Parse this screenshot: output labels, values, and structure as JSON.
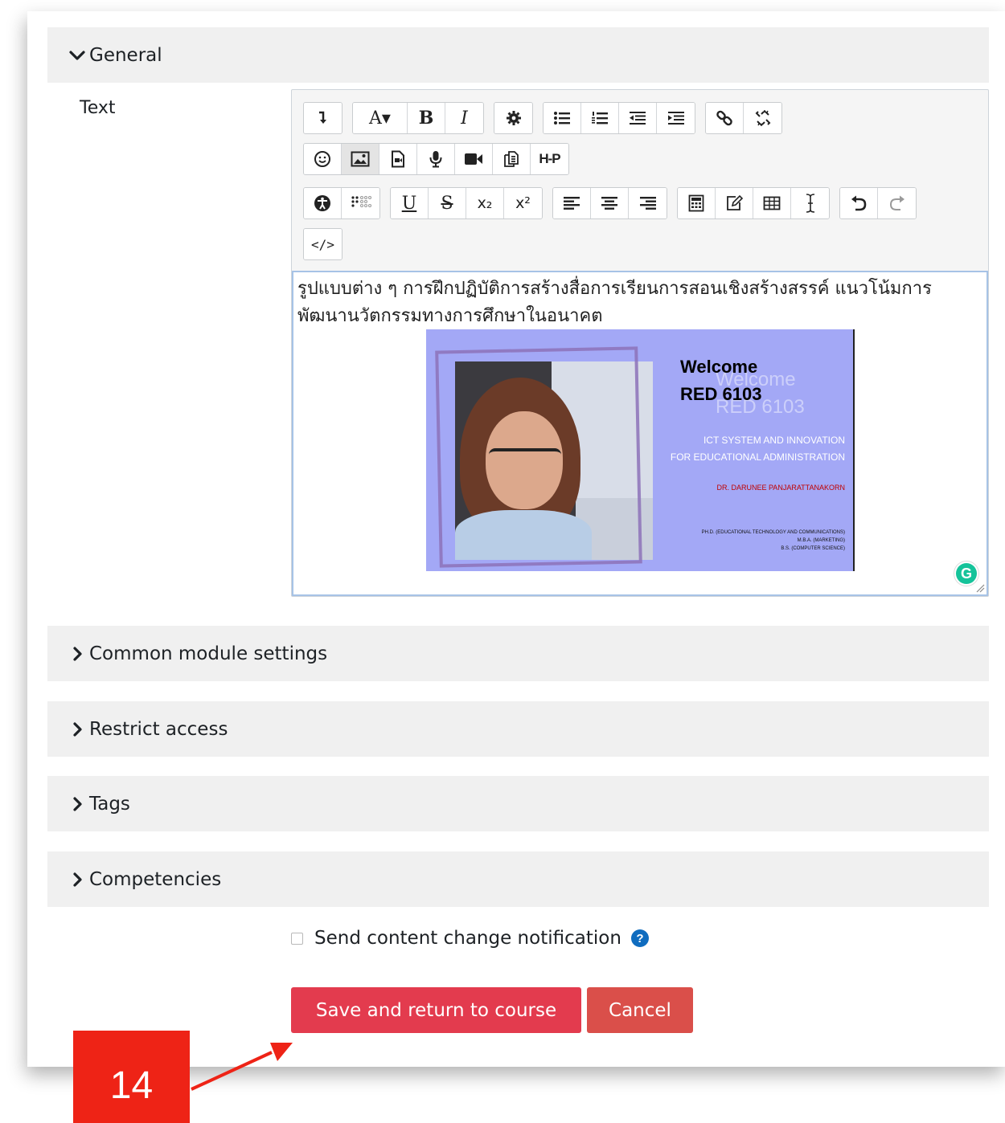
{
  "sections": {
    "general": "General",
    "common_module_settings": "Common module settings",
    "restrict_access": "Restrict access",
    "tags": "Tags",
    "competencies": "Competencies"
  },
  "text_field": {
    "label": "Text",
    "content": "รูปแบบต่าง ๆ การฝึกปฏิบัติการสร้างสื่อการเรียนการสอนเชิงสร้างสรรค์ แนวโน้มการพัฒนานวัตกรรมทางการศึกษาในอนาคต"
  },
  "toolbar": {
    "row1": [
      "expand-toolbar-icon",
      "font-color-icon",
      "bold-icon",
      "italic-icon",
      "settings-icon",
      "bulleted-list-icon",
      "numbered-list-icon",
      "outdent-icon",
      "indent-icon",
      "link-icon",
      "unlink-icon"
    ],
    "row2": [
      "emoji-icon",
      "image-icon",
      "media-file-icon",
      "record-audio-icon",
      "record-video-icon",
      "manage-files-icon",
      "h5p-icon"
    ],
    "row3": [
      "accessibility-checker-icon",
      "screenreader-helper-icon",
      "underline-icon",
      "strikethrough-icon",
      "subscript-icon",
      "superscript-icon",
      "align-left-icon",
      "align-center-icon",
      "align-right-icon",
      "equation-editor-icon",
      "edit-icon",
      "table-icon",
      "clear-formatting-icon",
      "undo-icon",
      "redo-icon"
    ],
    "row4": [
      "html-source-icon"
    ],
    "h5p_label": "H-P",
    "bold_label": "B",
    "italic_label": "I",
    "underline_label": "U",
    "strike_label": "S",
    "font_label": "A▾",
    "sub_label": "x₂",
    "sup_label": "x²",
    "code_label": "</>"
  },
  "embedded_image": {
    "title_line1": "Welcome",
    "title_line2": "RED 6103",
    "subtitle_line1": "ICT SYSTEM AND INNOVATION",
    "subtitle_line2": "FOR EDUCATIONAL ADMINISTRATION",
    "author": "DR. DARUNEE PANJARATTANAKORN",
    "degree1": "PH.D. (EDUCATIONAL TECHNOLOGY AND COMMUNICATIONS)",
    "degree2": "M.B.A. (MARKETING)",
    "degree3": "B.S. (COMPUTER SCIENCE)"
  },
  "grammarly_label": "G",
  "notification": {
    "label": "Send content change notification",
    "checked": false,
    "help_label": "?"
  },
  "buttons": {
    "save": "Save and return to course",
    "cancel": "Cancel"
  },
  "callout": {
    "number": "14"
  },
  "colors": {
    "save_button": "#e33b4e",
    "cancel_button": "#da4f4a",
    "callout": "#ee2316",
    "section_bg": "#f0f0f0",
    "help_icon": "#0f6cbf"
  }
}
